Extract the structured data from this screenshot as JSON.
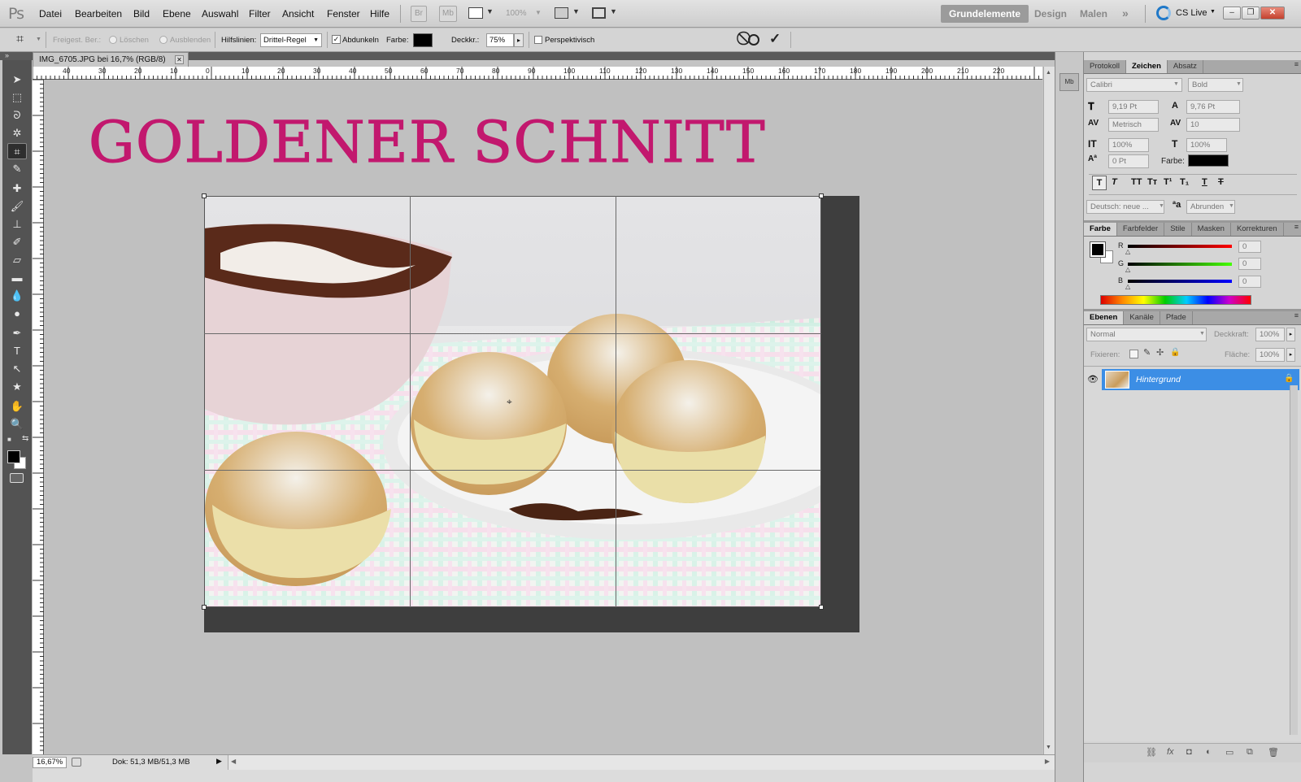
{
  "app": {
    "logo": "Ps"
  },
  "menu": [
    "Datei",
    "Bearbeiten",
    "Bild",
    "Ebene",
    "Auswahl",
    "Filter",
    "Ansicht",
    "Fenster",
    "Hilfe"
  ],
  "appbar": {
    "zoom": "100%",
    "br": "Br",
    "mb": "Mb"
  },
  "workspaces": [
    "Grundelemente",
    "Design",
    "Malen"
  ],
  "cslive": "CS Live",
  "options": {
    "freigest": "Freigest. Ber.:",
    "loeschen": "Löschen",
    "ausblenden": "Ausblenden",
    "hilfslinien_label": "Hilfslinien:",
    "hilfslinien_value": "Drittel-Regel",
    "abdunkeln": "Abdunkeln",
    "farbe_label": "Farbe:",
    "deckkr_label": "Deckkr.:",
    "deckkr_value": "75%",
    "perspektivisch": "Perspektivisch"
  },
  "document": {
    "tab_title": "IMG_6705.JPG bei 16,7% (RGB/8)",
    "heading": "GOLDENER SCHNITT",
    "heading_color": "#c2186e",
    "ruler_labels": [
      "40",
      "30",
      "20",
      "10",
      "0",
      "10",
      "20",
      "30",
      "40",
      "50",
      "60",
      "70",
      "80",
      "90",
      "100",
      "110",
      "120",
      "130",
      "140",
      "150",
      "160",
      "170",
      "180",
      "190",
      "200",
      "210",
      "220"
    ]
  },
  "status": {
    "zoom": "16,67%",
    "doc": "Dok: 51,3 MB/51,3 MB"
  },
  "char_panel": {
    "tabs": [
      "Protokoll",
      "Zeichen",
      "Absatz"
    ],
    "font": "Calibri",
    "style": "Bold",
    "size": "9,19 Pt",
    "leading": "9,76 Pt",
    "kerning": "Metrisch",
    "tracking": "10",
    "vscale": "100%",
    "hscale": "100%",
    "baseline": "0 Pt",
    "farbe_label": "Farbe:",
    "language": "Deutsch: neue ...",
    "aa_label": "a",
    "antialias": "Abrunden"
  },
  "color_panel": {
    "tabs": [
      "Farbe",
      "Farbfelder",
      "Stile",
      "Masken",
      "Korrekturen"
    ],
    "r_label": "R",
    "g_label": "G",
    "b_label": "B",
    "r": "0",
    "g": "0",
    "b": "0"
  },
  "layers_panel": {
    "tabs": [
      "Ebenen",
      "Kanäle",
      "Pfade"
    ],
    "mode": "Normal",
    "deckkraft_label": "Deckkraft:",
    "deckkraft": "100%",
    "fixieren_label": "Fixieren:",
    "flaeche_label": "Fläche:",
    "flaeche": "100%",
    "layer_name": "Hintergrund"
  }
}
